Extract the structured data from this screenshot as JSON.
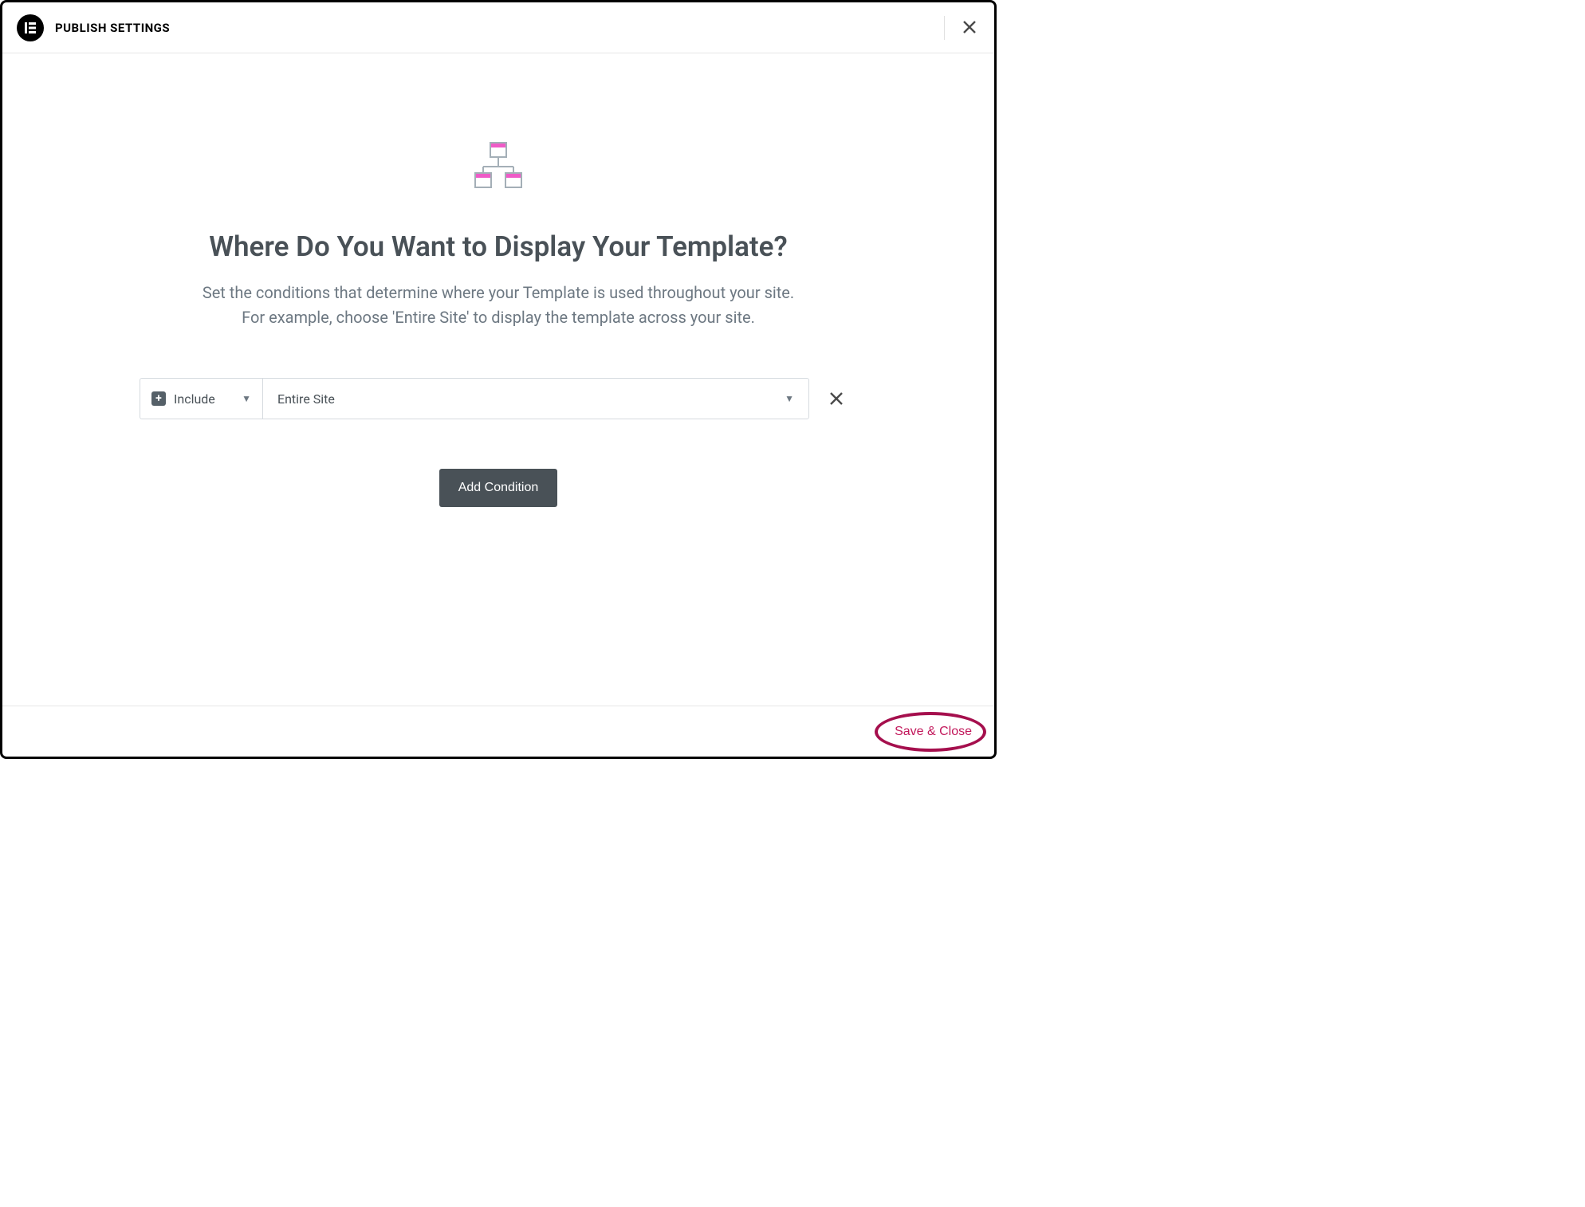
{
  "header": {
    "logo_text": "E",
    "title": "PUBLISH SETTINGS"
  },
  "main": {
    "heading": "Where Do You Want to Display Your Template?",
    "sub1": "Set the conditions that determine where your Template is used throughout your site.",
    "sub2": "For example, choose 'Entire Site' to display the template across your site."
  },
  "condition": {
    "include_label": "Include",
    "scope_value": "Entire Site"
  },
  "buttons": {
    "add_condition": "Add Condition",
    "save_close": "Save & Close"
  }
}
